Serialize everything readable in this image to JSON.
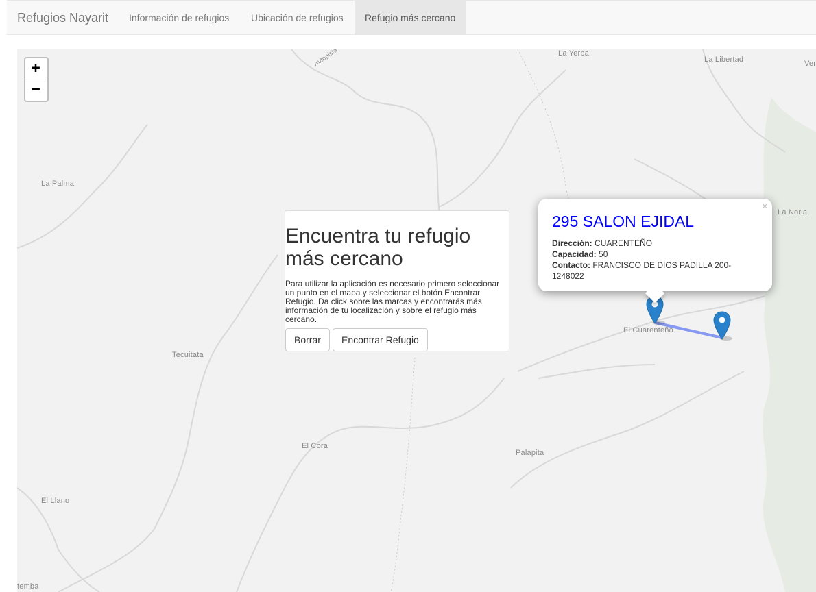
{
  "navbar": {
    "brand": "Refugios Nayarit",
    "links": [
      {
        "label": "Información de refugios"
      },
      {
        "label": "Ubicación de refugios"
      },
      {
        "label": "Refugio más cercano"
      }
    ]
  },
  "map": {
    "zoom": {
      "in_label": "+",
      "out_label": "−"
    },
    "places": [
      {
        "name": "La Yerba"
      },
      {
        "name": "La Libertad"
      },
      {
        "name": "La Palma"
      },
      {
        "name": "La Noria"
      },
      {
        "name": "El Cuarenteño"
      },
      {
        "name": "Tecuitata"
      },
      {
        "name": "El Cora"
      },
      {
        "name": "Palapita"
      },
      {
        "name": "El Llano"
      },
      {
        "name": "Autopista"
      },
      {
        "name": "Ver"
      },
      {
        "name": "temba"
      }
    ]
  },
  "info_card": {
    "title": "Encuentra tu refugio más cercano",
    "text": "Para utilizar la aplicación es necesario primero seleccionar un punto en el mapa y seleccionar el botón Encontrar Refugio. Da click sobre las marcas y encontrarás más información de tu localización y sobre el refugio más cercano.",
    "clear_button": "Borrar",
    "find_button": "Encontrar Refugio"
  },
  "popup": {
    "close_label": "×",
    "title": "295 SALON EJIDAL",
    "fields": [
      {
        "label": "Dirección:",
        "value": "CUARENTEÑO"
      },
      {
        "label": "Capacidad:",
        "value": "50"
      },
      {
        "label": "Contacto:",
        "value": "FRANCISCO DE DIOS PADILLA 200-1248022"
      }
    ]
  },
  "colors": {
    "marker": "#2a81cb",
    "route": "#7b8ff0",
    "popup_title": "#0000ff"
  }
}
